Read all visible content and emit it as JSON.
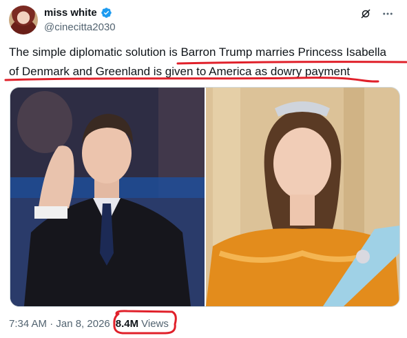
{
  "author": {
    "display_name": "miss white",
    "handle": "@cinecitta2030",
    "verified": true
  },
  "icons": {
    "verified": "verified-badge-icon",
    "grok": "grok-icon",
    "more": "more-options-icon"
  },
  "tweet": {
    "line1": "The simple diplomatic solution is Barron Trump marries Princess Isabella",
    "line2": "of Denmark and Greenland is given to America as dowry payment"
  },
  "meta": {
    "timestamp": "7:34 AM · Jan 8, 2026",
    "views_count": "8.4M",
    "views_label": "Views"
  },
  "colors": {
    "accent_blue": "#1d9bf0",
    "annotation_red": "#e0202a",
    "secondary_text": "#536471"
  }
}
